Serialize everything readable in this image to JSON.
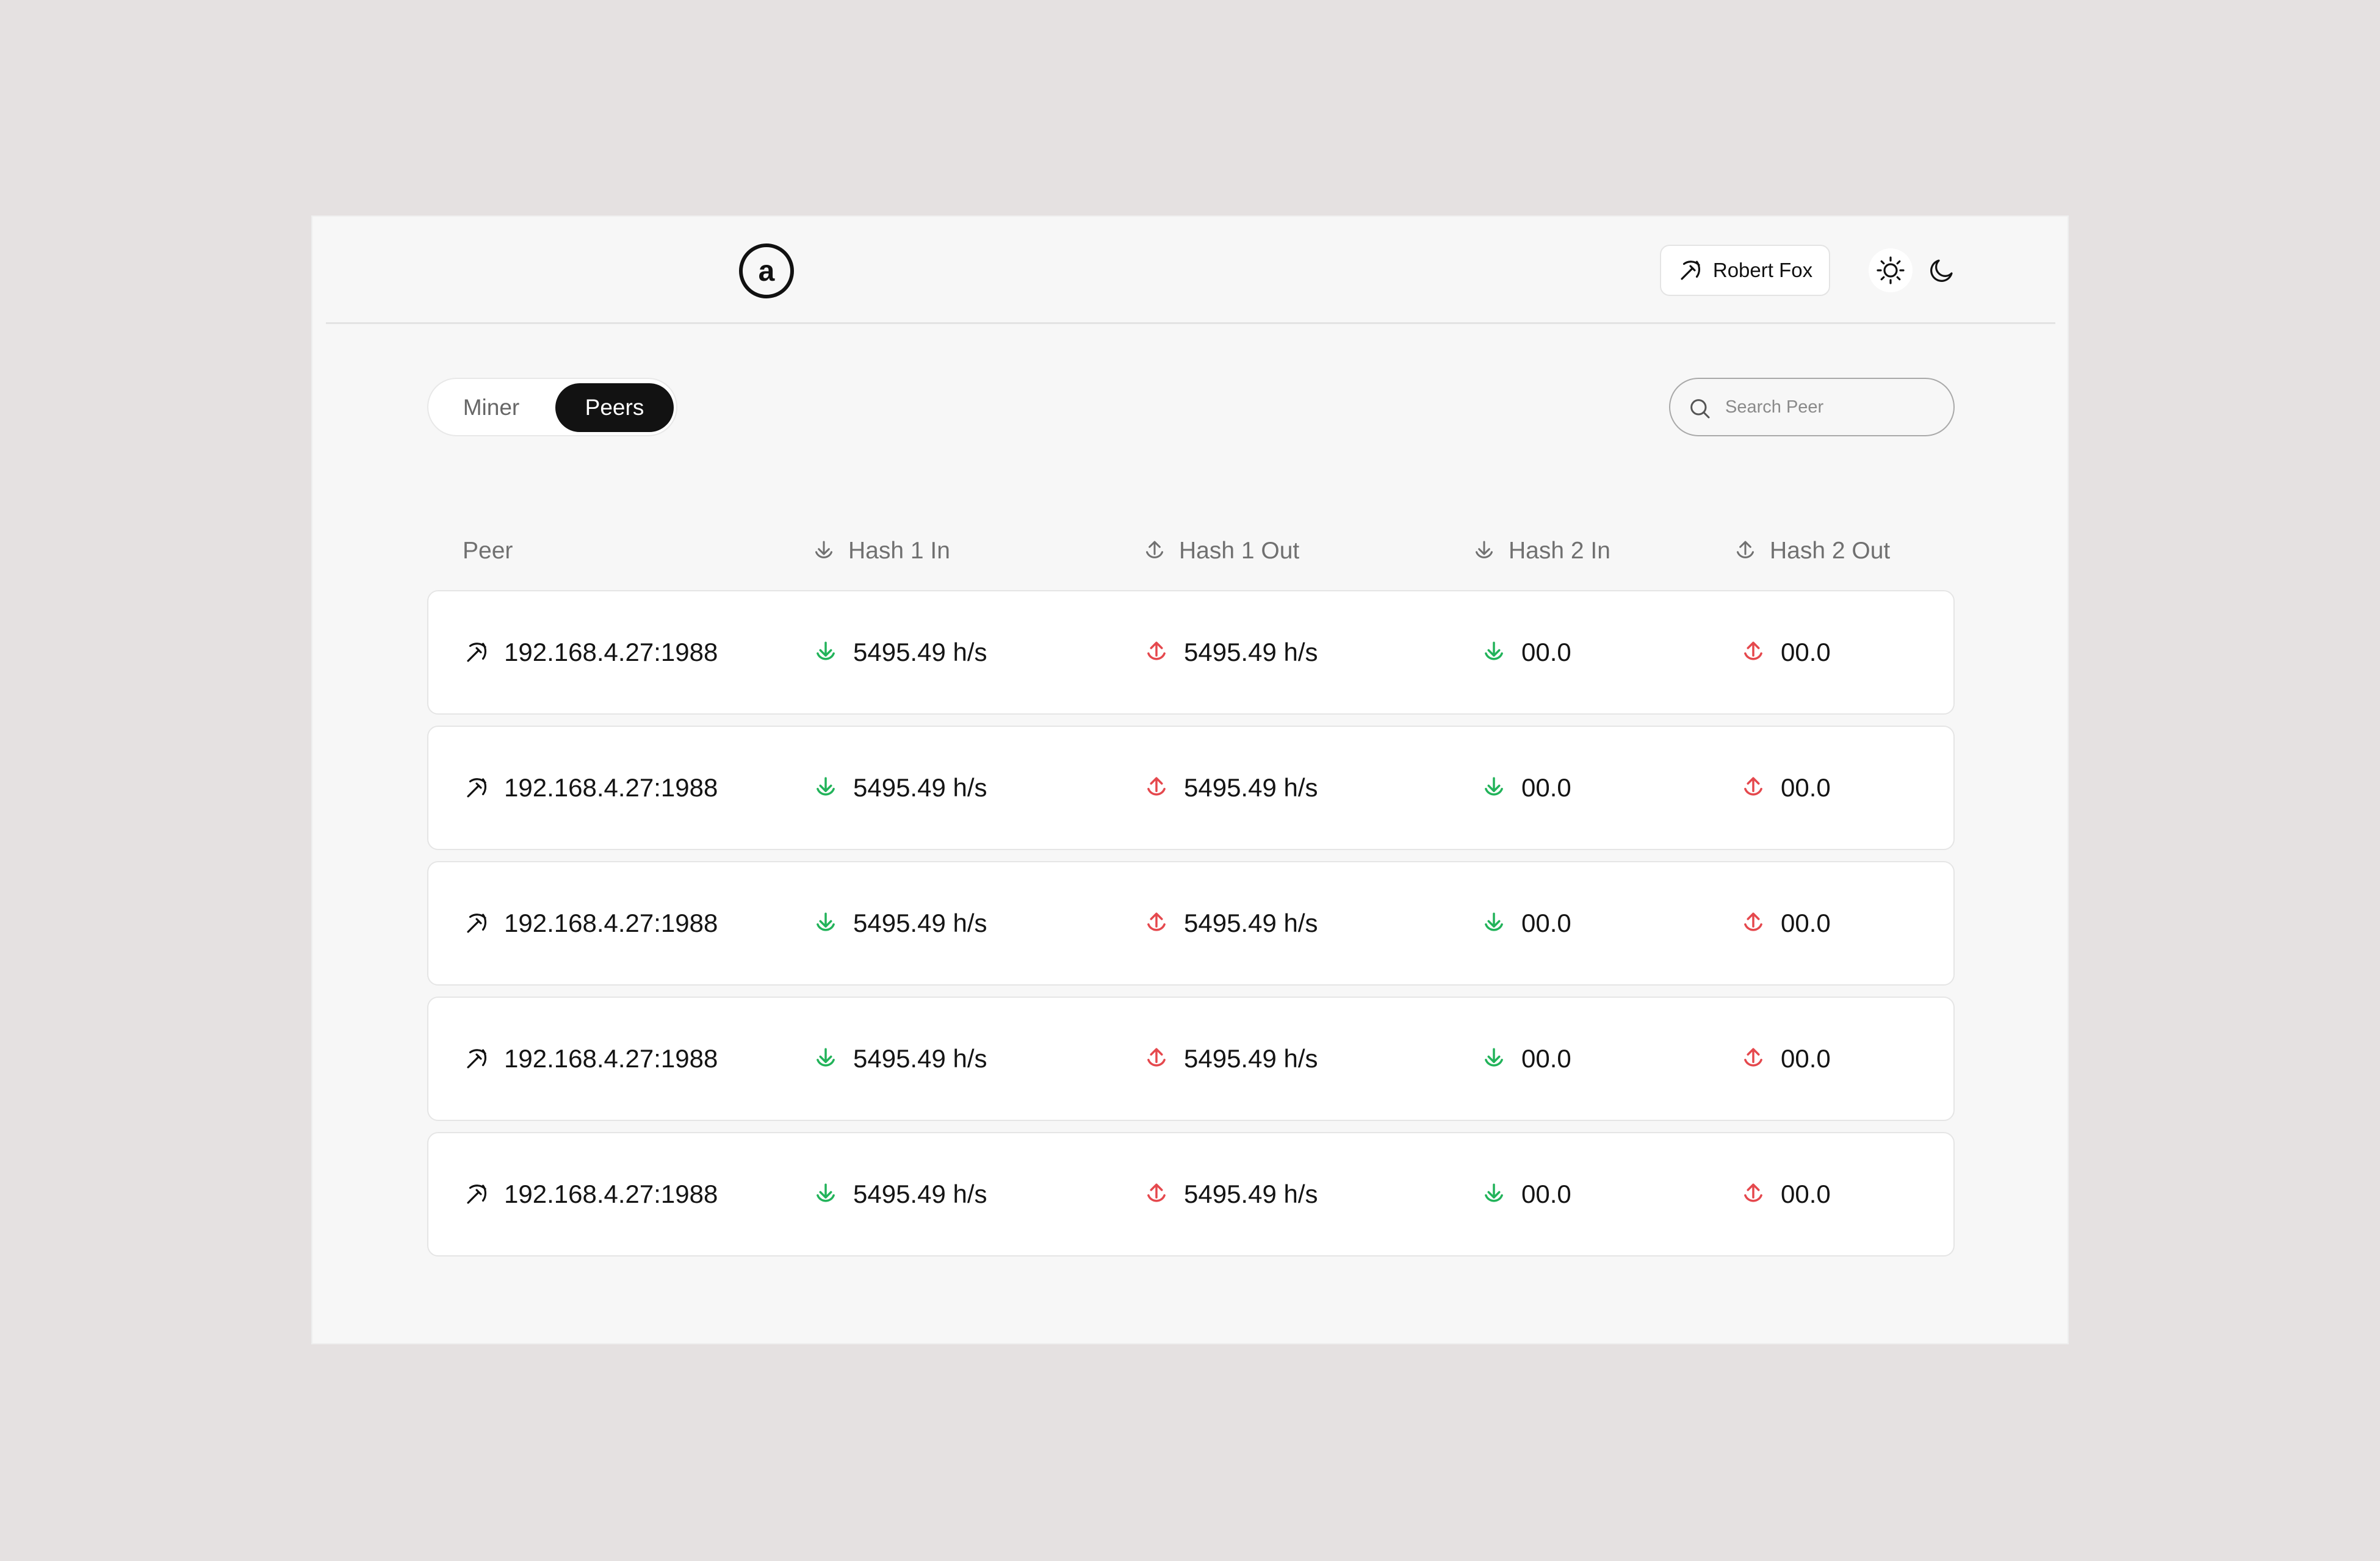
{
  "header": {
    "logo_letter": "a",
    "user_name": "Robert Fox",
    "theme_light_icon": "sun-icon",
    "theme_dark_icon": "moon-icon"
  },
  "tabs": [
    {
      "label": "Miner",
      "active": false
    },
    {
      "label": "Peers",
      "active": true
    }
  ],
  "search": {
    "placeholder": "Search Peer",
    "value": ""
  },
  "colors": {
    "download": "#22b35a",
    "upload": "#e5484d",
    "active_tab": "#121212"
  },
  "table": {
    "columns": [
      {
        "label": "Peer",
        "icon": ""
      },
      {
        "label": "Hash 1 In",
        "icon": "download-icon"
      },
      {
        "label": "Hash 1 Out",
        "icon": "upload-icon"
      },
      {
        "label": "Hash 2 In",
        "icon": "download-icon"
      },
      {
        "label": "Hash 2 Out",
        "icon": "upload-icon"
      }
    ],
    "rows": [
      {
        "peer": "192.168.4.27:1988",
        "hash1_in": "5495.49 h/s",
        "hash1_out": "5495.49 h/s",
        "hash2_in": "00.0",
        "hash2_out": "00.0"
      },
      {
        "peer": "192.168.4.27:1988",
        "hash1_in": "5495.49 h/s",
        "hash1_out": "5495.49 h/s",
        "hash2_in": "00.0",
        "hash2_out": "00.0"
      },
      {
        "peer": "192.168.4.27:1988",
        "hash1_in": "5495.49 h/s",
        "hash1_out": "5495.49 h/s",
        "hash2_in": "00.0",
        "hash2_out": "00.0"
      },
      {
        "peer": "192.168.4.27:1988",
        "hash1_in": "5495.49 h/s",
        "hash1_out": "5495.49 h/s",
        "hash2_in": "00.0",
        "hash2_out": "00.0"
      },
      {
        "peer": "192.168.4.27:1988",
        "hash1_in": "5495.49 h/s",
        "hash1_out": "5495.49 h/s",
        "hash2_in": "00.0",
        "hash2_out": "00.0"
      }
    ]
  }
}
